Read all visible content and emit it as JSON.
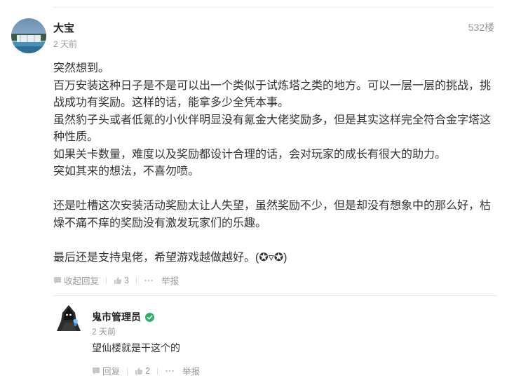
{
  "post": {
    "author": "大宝",
    "time": "2 天前",
    "floor": "532楼",
    "paragraphs": [
      "突然想到。",
      "百万安装这种日子是不是可以出一个类似于试炼塔之类的地方。可以一层一层的挑战，挑战成功有奖励。这样的话，能拿多少全凭本事。",
      "虽然豹子头或者低氪的小伙伴明显没有氪金大佬奖励多，但是其实这样完全符合金字塔这种性质。",
      "如果关卡数量，难度以及奖励都设计合理的话，会对玩家的成长有很大的助力。",
      "突如其来的想法，不喜勿喷。",
      "",
      "还是吐槽这次安装活动奖励太让人失望，虽然奖励不少，但是却没有想象中的那么好，枯燥不痛不痒的奖励没有激发玩家们的乐趣。",
      "",
      "最后还是支持鬼佬，希望游戏越做越好。(✪▿✪)"
    ],
    "actions": {
      "collapse_label": "收起回复",
      "like_count": "3",
      "report_label": "举报"
    }
  },
  "reply": {
    "author": "鬼市管理员",
    "time": "2 天前",
    "text": "望仙楼就是干这个的",
    "actions": {
      "reply_label": "回复",
      "like_count": "2",
      "report_label": "举报"
    }
  },
  "colors": {
    "verified": "#2fb36a",
    "muted": "#999999"
  }
}
